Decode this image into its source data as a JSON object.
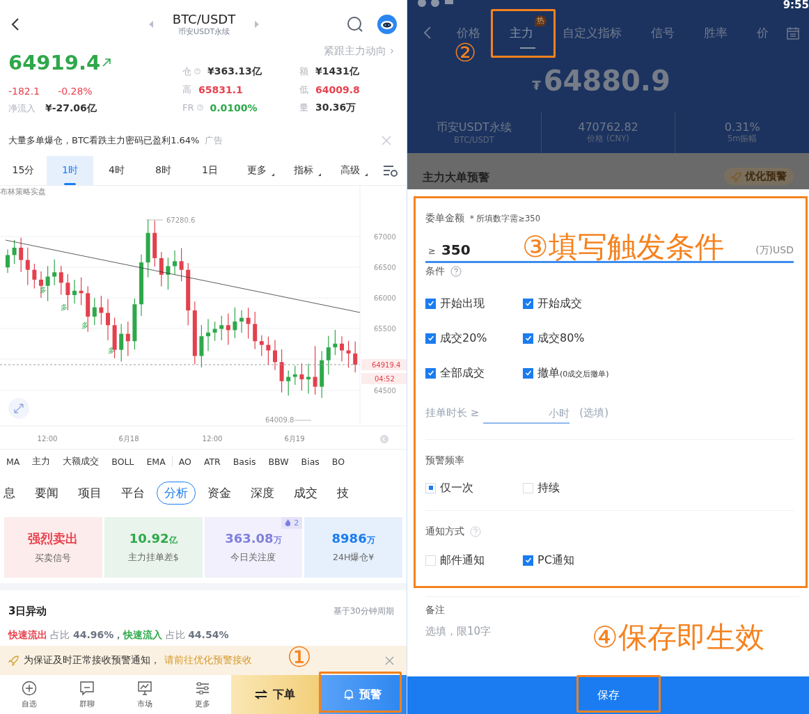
{
  "left": {
    "header": {
      "title": "BTC/USDT",
      "subtitle": "币安USDT永续"
    },
    "follow_link": "紧跟主力动向 ›",
    "price": {
      "value": "64919.4",
      "change": "-182.1",
      "change_pct": "-0.28%",
      "net_flow_label": "净流入",
      "net_flow": "¥-27.06亿"
    },
    "stats": [
      {
        "label": "仓",
        "help": true,
        "value": "¥363.13亿",
        "kind": "plain"
      },
      {
        "label": "额",
        "help": false,
        "value": "¥1431亿",
        "kind": "plain"
      },
      {
        "label": "高",
        "help": false,
        "value": "65831.1",
        "kind": "down"
      },
      {
        "label": "低",
        "help": false,
        "value": "64009.8",
        "kind": "down"
      },
      {
        "label": "FR",
        "help": true,
        "value": "0.0100%",
        "kind": "up"
      },
      {
        "label": "量",
        "help": false,
        "value": "30.36万",
        "kind": "plain"
      }
    ],
    "ad": {
      "text": "大量多单爆仓，BTC看跌主力密码已盈利1.64%",
      "tag": "广告"
    },
    "intervals": [
      {
        "label": "15分",
        "selected": false,
        "dropdown": false
      },
      {
        "label": "1时",
        "selected": true,
        "dropdown": false
      },
      {
        "label": "4时",
        "selected": false,
        "dropdown": false
      },
      {
        "label": "8时",
        "selected": false,
        "dropdown": false
      },
      {
        "label": "1日",
        "selected": false,
        "dropdown": false
      },
      {
        "label": "更多",
        "selected": false,
        "dropdown": true
      },
      {
        "label": "指标",
        "selected": false,
        "dropdown": true
      },
      {
        "label": "高级",
        "selected": false,
        "dropdown": true
      }
    ],
    "chart": {
      "strategy": "布林策略实盘",
      "yticks": [
        "67000",
        "66500",
        "66000",
        "65500",
        "64500"
      ],
      "xlabels": [
        "12:00",
        "6月18",
        "12:00",
        "6月19"
      ],
      "high": "67280.6",
      "low": "64009.8",
      "last_price": "64919.4",
      "countdown": "04:52",
      "signals": [
        "多",
        "多",
        "多",
        "多"
      ]
    },
    "indicators": [
      "MA",
      "主力",
      "大额成交",
      "BOLL",
      "EMA",
      "AO",
      "ATR",
      "Basis",
      "BBW",
      "Bias",
      "BO"
    ],
    "tabs": [
      {
        "label": "息",
        "selected": false
      },
      {
        "label": "要闻",
        "selected": false
      },
      {
        "label": "项目",
        "selected": false
      },
      {
        "label": "平台",
        "selected": false
      },
      {
        "label": "分析",
        "selected": true
      },
      {
        "label": "资金",
        "selected": false
      },
      {
        "label": "深度",
        "selected": false
      },
      {
        "label": "成交",
        "selected": false
      },
      {
        "label": "技",
        "selected": false
      }
    ],
    "cards": [
      {
        "value": "强烈卖出",
        "label": "买卖信号",
        "kind": "sell"
      },
      {
        "value": "10.92",
        "unit": "亿",
        "label": "主力挂单差$",
        "kind": "green"
      },
      {
        "value": "363.08",
        "unit": "万",
        "label": "今日关注度",
        "kind": "purple",
        "badge": "2"
      },
      {
        "value": "8986",
        "unit": "万",
        "label": "24H爆仓¥",
        "kind": "blue"
      }
    ],
    "anomaly": {
      "title": "3日异动",
      "note": "基于30分钟周期",
      "items": [
        {
          "label": "快速流出",
          "kind": "out",
          "share": "占比",
          "value": "44.96%，"
        },
        {
          "label": "快速流入",
          "kind": "in",
          "share": "占比",
          "value": "44.54%"
        }
      ]
    },
    "notice": {
      "text": "为保证及时正常接收预警通知，",
      "link": "请前往优化预警接收"
    },
    "nav": [
      {
        "label": "自选",
        "kind": "plus"
      },
      {
        "label": "群聊",
        "kind": "chat"
      },
      {
        "label": "市场",
        "kind": "monitor"
      },
      {
        "label": "更多",
        "kind": "sliders"
      }
    ],
    "order_button": "下单",
    "alert_button": "预警"
  },
  "right": {
    "status_time": "9:55",
    "tabs": [
      {
        "label": "价格",
        "selected": false
      },
      {
        "label": "主力",
        "selected": true,
        "badge": "热"
      },
      {
        "label": "自定义指标",
        "selected": false
      },
      {
        "label": "信号",
        "selected": false
      },
      {
        "label": "胜率",
        "selected": false
      },
      {
        "label": "价",
        "selected": false
      }
    ],
    "price": {
      "currency": "₮",
      "value": "64880.9"
    },
    "stats": [
      {
        "value": "币安USDT永续",
        "label": "BTC/USDT"
      },
      {
        "value": "470762.82",
        "label": "价格 (CNY)"
      },
      {
        "value": "0.31%",
        "label": "5m振幅"
      }
    ],
    "section_title": "主力大单预警",
    "optimize_button": "优化预警",
    "form": {
      "amount_label": "委单金额",
      "amount_hint": "* 所填数字需≥350",
      "amount_prefix": "≥",
      "amount_value": "350",
      "amount_unit": "(万)USD",
      "conditions_label": "条件",
      "conditions": [
        {
          "label": "开始出现",
          "checked": true
        },
        {
          "label": "开始成交",
          "checked": true
        },
        {
          "label": "成交20%",
          "checked": true
        },
        {
          "label": "成交80%",
          "checked": true
        },
        {
          "label": "全部成交",
          "checked": true
        },
        {
          "label": "撤单",
          "note": "(0成交后撤单)",
          "checked": true
        }
      ],
      "duration_label": "挂单时长 ≥",
      "duration_unit": "小时",
      "duration_optional": "(选填)",
      "frequency_label": "预警频率",
      "frequency": [
        {
          "label": "仅一次",
          "selected": true
        },
        {
          "label": "持续",
          "selected": false
        }
      ],
      "notify_label": "通知方式",
      "notify": [
        {
          "label": "邮件通知",
          "checked": false
        },
        {
          "label": "PC通知",
          "checked": true
        }
      ],
      "remark_label": "备注",
      "remark_placeholder": "选填，限10字"
    },
    "save_button": "保存"
  },
  "annotations": [
    {
      "text": "①",
      "kind": "step1"
    },
    {
      "text": "②",
      "kind": "step2"
    },
    {
      "text": "③填写触发条件",
      "kind": "step3"
    },
    {
      "text": "④保存即生效",
      "kind": "step4"
    }
  ]
}
